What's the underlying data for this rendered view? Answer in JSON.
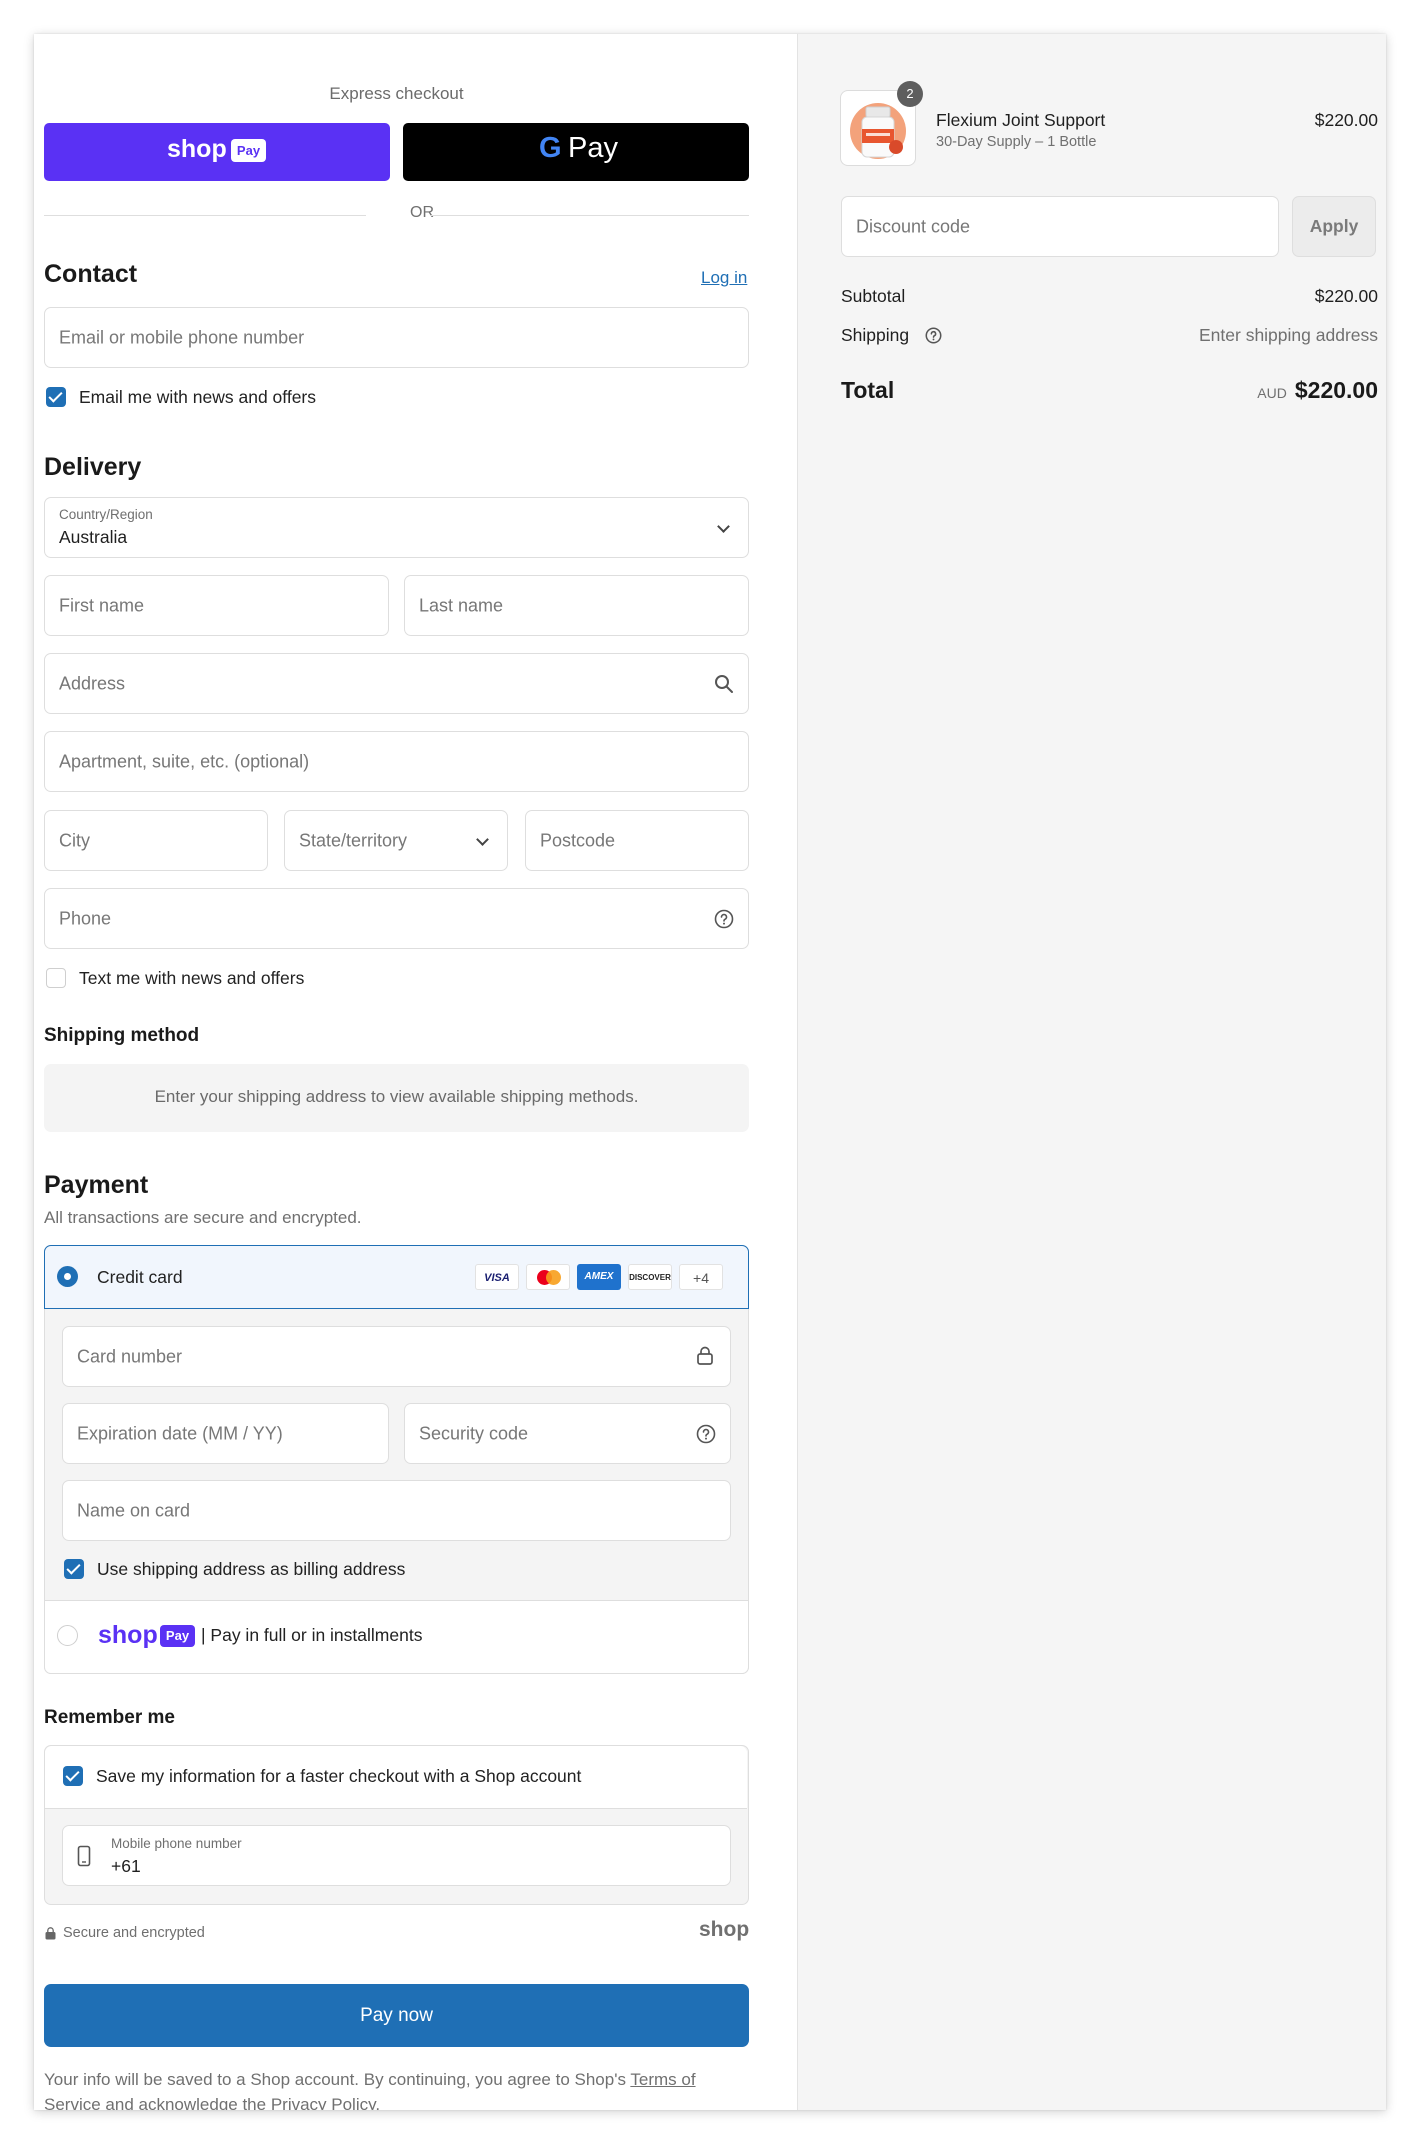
{
  "express": {
    "title": "Express checkout",
    "shop_pay_word": "shop",
    "shop_pay_badge": "Pay",
    "gpay_g": "G",
    "gpay_label": "Pay",
    "or": "OR"
  },
  "contact": {
    "heading": "Contact",
    "login_link": "Log in",
    "email_placeholder": "Email or mobile phone number",
    "email_news_label": "Email me with news and offers"
  },
  "delivery": {
    "heading": "Delivery",
    "country_label": "Country/Region",
    "country_value": "Australia",
    "first_name_placeholder": "First name",
    "last_name_placeholder": "Last name",
    "address_placeholder": "Address",
    "apartment_placeholder": "Apartment, suite, etc. (optional)",
    "city_placeholder": "City",
    "state_placeholder": "State/territory",
    "postcode_placeholder": "Postcode",
    "phone_placeholder": "Phone",
    "text_news_label": "Text me with news and offers"
  },
  "shipping_method": {
    "heading": "Shipping method",
    "notice": "Enter your shipping address to view available shipping methods."
  },
  "payment": {
    "heading": "Payment",
    "subtitle": "All transactions are secure and encrypted.",
    "credit_card_label": "Credit card",
    "brands": [
      "VISA",
      "MC",
      "AMEX",
      "DISCOVER"
    ],
    "more_brands": "+4",
    "card_number_placeholder": "Card number",
    "expiration_placeholder": "Expiration date (MM / YY)",
    "security_code_placeholder": "Security code",
    "name_on_card_placeholder": "Name on card",
    "billing_same_label": "Use shipping address as billing address",
    "shop_pay_word": "shop",
    "shop_pay_badge": "Pay",
    "shop_pay_desc": "| Pay in full or in installments"
  },
  "remember": {
    "heading": "Remember me",
    "save_info_label": "Save my information for a faster checkout with a Shop account",
    "mobile_label": "Mobile phone number",
    "mobile_value": "+61",
    "secure_text": "Secure and encrypted",
    "shop_logo": "shop"
  },
  "pay_now_label": "Pay now",
  "legal": {
    "text_1": "Your info will be saved to a Shop account. By continuing, you agree to Shop's ",
    "terms_link_1": "Terms of",
    "terms_link_2": "Service",
    "text_2": " and acknowledge the ",
    "privacy_link": "Privacy Policy",
    "text_3": "."
  },
  "summary": {
    "product_name": "Flexium Joint Support",
    "product_variant": "30-Day Supply – 1 Bottle",
    "product_price": "$220.00",
    "quantity": "2",
    "discount_placeholder": "Discount code",
    "apply_label": "Apply",
    "subtotal_label": "Subtotal",
    "subtotal_value": "$220.00",
    "shipping_label": "Shipping",
    "shipping_value": "Enter shipping address",
    "total_label": "Total",
    "currency": "AUD",
    "total_value": "$220.00"
  },
  "colors": {
    "shop_purple": "#5a31f4",
    "primary_blue": "#1f6fb5",
    "accent_selected_bg": "#f1f6fd"
  }
}
